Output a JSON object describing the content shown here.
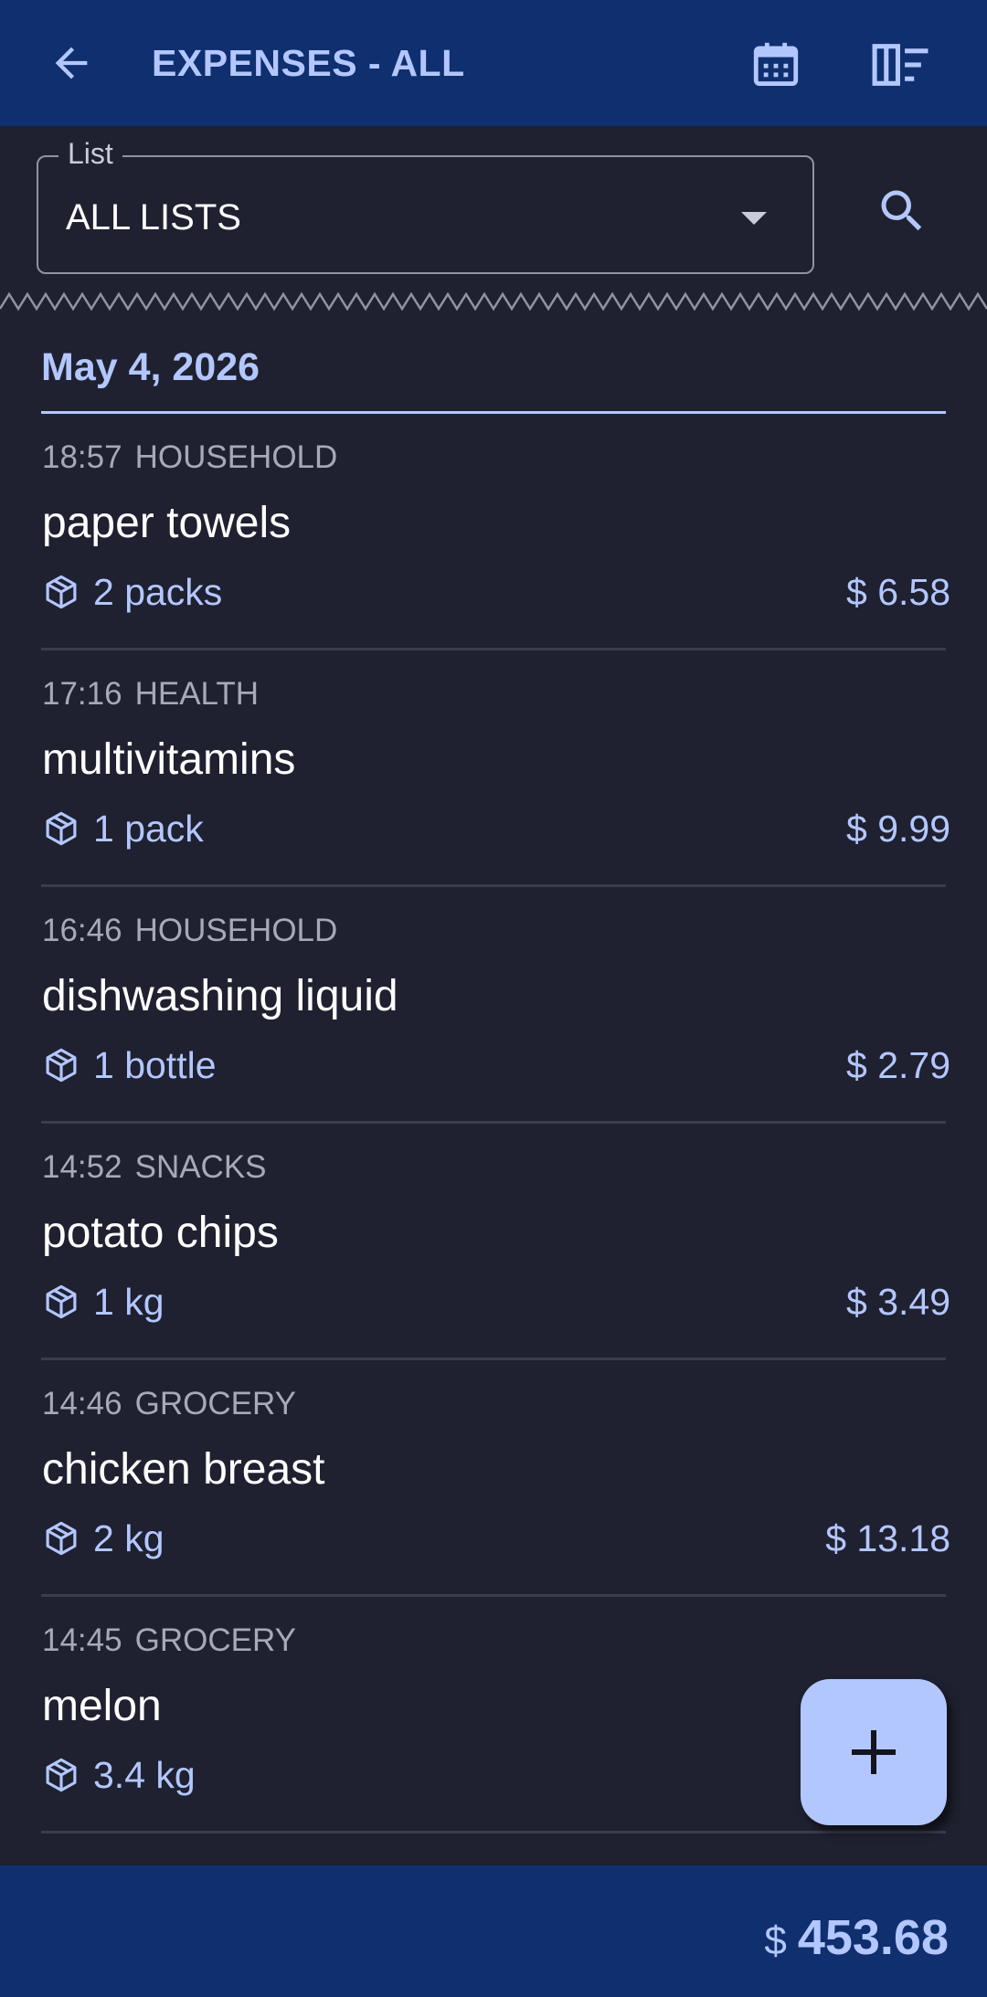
{
  "appbar": {
    "title": "EXPENSES - ALL",
    "back_icon": "arrow-left-icon",
    "calendar_icon": "calendar-icon",
    "filter_icon": "filter-list-icon"
  },
  "filter": {
    "label": "List",
    "value": "ALL LISTS",
    "search_icon": "search-icon"
  },
  "date_group": "May 4, 2026",
  "items": [
    {
      "time": "18:57",
      "category": "HOUSEHOLD",
      "name": "paper towels",
      "quantity": "2 packs",
      "price": "$ 6.58"
    },
    {
      "time": "17:16",
      "category": "HEALTH",
      "name": "multivitamins",
      "quantity": "1 pack",
      "price": "$ 9.99"
    },
    {
      "time": "16:46",
      "category": "HOUSEHOLD",
      "name": "dishwashing liquid",
      "quantity": "1 bottle",
      "price": "$ 2.79"
    },
    {
      "time": "14:52",
      "category": "SNACKS",
      "name": "potato chips",
      "quantity": "1 kg",
      "price": "$ 3.49"
    },
    {
      "time": "14:46",
      "category": "GROCERY",
      "name": "chicken breast",
      "quantity": "2 kg",
      "price": "$ 13.18"
    },
    {
      "time": "14:45",
      "category": "GROCERY",
      "name": "melon",
      "quantity": "3.4 kg",
      "price": ""
    }
  ],
  "fab": {
    "icon": "plus-icon"
  },
  "footer": {
    "currency": "$",
    "total": "453.68"
  },
  "colors": {
    "appbar": "#0f2f6f",
    "background": "#1f2130",
    "accent": "#b3c7ff"
  }
}
